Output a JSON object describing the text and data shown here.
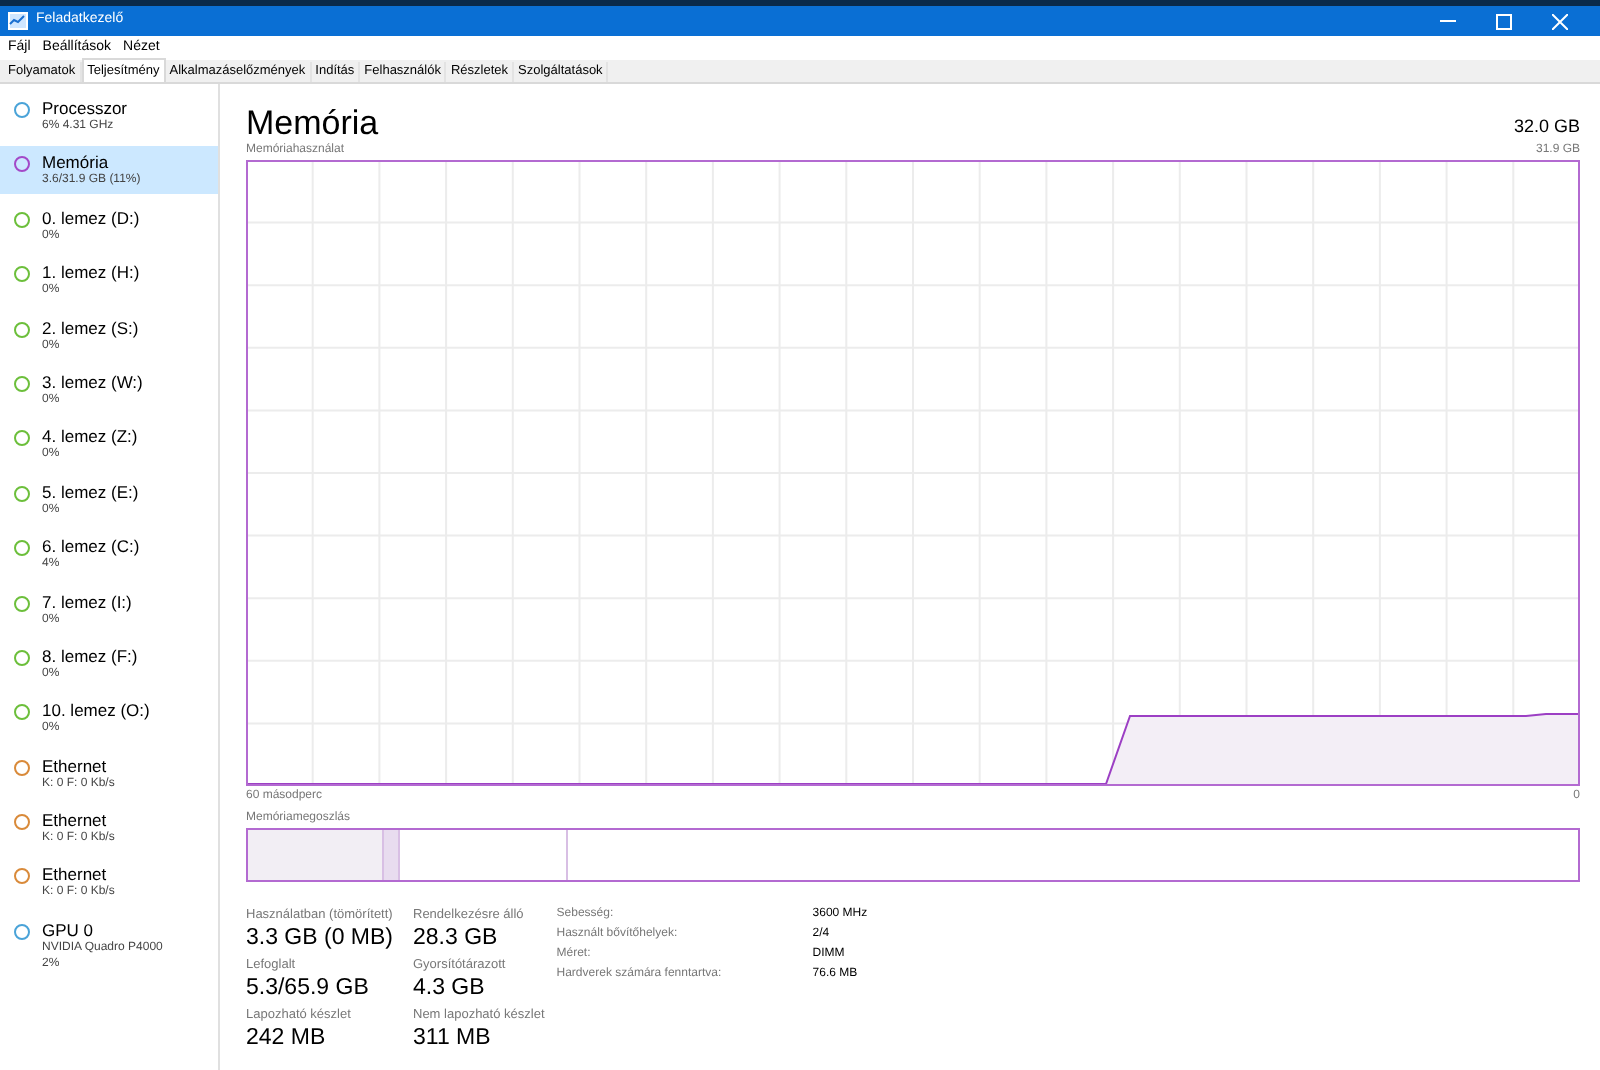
{
  "window": {
    "title": "Feladatkezelő"
  },
  "menu": [
    "Fájl",
    "Beállítások",
    "Nézet"
  ],
  "tabs": [
    {
      "label": "Folyamatok",
      "selected": false
    },
    {
      "label": "Teljesítmény",
      "selected": true
    },
    {
      "label": "Alkalmazáselőzmények",
      "selected": false
    },
    {
      "label": "Indítás",
      "selected": false
    },
    {
      "label": "Felhasználók",
      "selected": false
    },
    {
      "label": "Részletek",
      "selected": false
    },
    {
      "label": "Szolgáltatások",
      "selected": false
    }
  ],
  "sidebar": {
    "items": [
      {
        "name": "Processzor",
        "lines": [
          "6% 4.31 GHz"
        ],
        "color": "#4aa3d8",
        "selected": false
      },
      {
        "name": "Memória",
        "lines": [
          "3.6/31.9 GB (11%)"
        ],
        "color": "#a349c8",
        "selected": true
      },
      {
        "name": "0. lemez (D:)",
        "lines": [
          "0%"
        ],
        "color": "#6cbf3b",
        "selected": false
      },
      {
        "name": "1. lemez (H:)",
        "lines": [
          "0%"
        ],
        "color": "#6cbf3b",
        "selected": false
      },
      {
        "name": "2. lemez (S:)",
        "lines": [
          "0%"
        ],
        "color": "#6cbf3b",
        "selected": false
      },
      {
        "name": "3. lemez (W:)",
        "lines": [
          "0%"
        ],
        "color": "#6cbf3b",
        "selected": false
      },
      {
        "name": "4. lemez (Z:)",
        "lines": [
          "0%"
        ],
        "color": "#6cbf3b",
        "selected": false
      },
      {
        "name": "5. lemez (E:)",
        "lines": [
          "0%"
        ],
        "color": "#6cbf3b",
        "selected": false
      },
      {
        "name": "6. lemez (C:)",
        "lines": [
          "4%"
        ],
        "color": "#6cbf3b",
        "selected": false
      },
      {
        "name": "7. lemez (I:)",
        "lines": [
          "0%"
        ],
        "color": "#6cbf3b",
        "selected": false
      },
      {
        "name": "8. lemez (F:)",
        "lines": [
          "0%"
        ],
        "color": "#6cbf3b",
        "selected": false
      },
      {
        "name": "10. lemez (O:)",
        "lines": [
          "0%"
        ],
        "color": "#6cbf3b",
        "selected": false
      },
      {
        "name": "Ethernet",
        "lines": [
          "K: 0 F: 0 Kb/s"
        ],
        "color": "#d98a3a",
        "selected": false
      },
      {
        "name": "Ethernet",
        "lines": [
          "K: 0 F: 0 Kb/s"
        ],
        "color": "#d98a3a",
        "selected": false
      },
      {
        "name": "Ethernet",
        "lines": [
          "K: 0 F: 0 Kb/s"
        ],
        "color": "#d98a3a",
        "selected": false
      },
      {
        "name": "GPU 0",
        "lines": [
          "NVIDIA Quadro P4000",
          "2%"
        ],
        "color": "#4aa3d8",
        "selected": false
      }
    ]
  },
  "main": {
    "title": "Memória",
    "total": "32.0 GB",
    "usage_graph": {
      "label": "Memóriahasználat",
      "max": "31.9 GB",
      "x_start": "60 másodperc",
      "x_end": "0"
    },
    "composition": {
      "label": "Memóriamegoszlás",
      "segments": [
        {
          "kind": "used",
          "level": 0.103
        },
        {
          "kind": "modified",
          "level": 0.011
        },
        {
          "kind": "standby",
          "level": 0.126
        }
      ]
    },
    "stats": [
      [
        {
          "label": "Használatban (tömörített)",
          "value": "3.3 GB (0 MB)"
        },
        {
          "label": "Rendelkezésre álló",
          "value": "28.3 GB"
        }
      ],
      [
        {
          "label": "Lefoglalt",
          "value": "5.3/65.9 GB"
        },
        {
          "label": "Gyorsítótárazott",
          "value": "4.3 GB"
        }
      ],
      [
        {
          "label": "Lapozható készlet",
          "value": "242 MB"
        },
        {
          "label": "Nem lapozható készlet",
          "value": "311 MB"
        }
      ]
    ],
    "details": [
      {
        "label": "Sebesség:",
        "value": "3600 MHz"
      },
      {
        "label": "Használt bővítőhelyek:",
        "value": "2/4"
      },
      {
        "label": "Méret:",
        "value": "DIMM"
      },
      {
        "label": "Hardverek számára fenntartva:",
        "value": "76.6 MB"
      }
    ]
  }
}
